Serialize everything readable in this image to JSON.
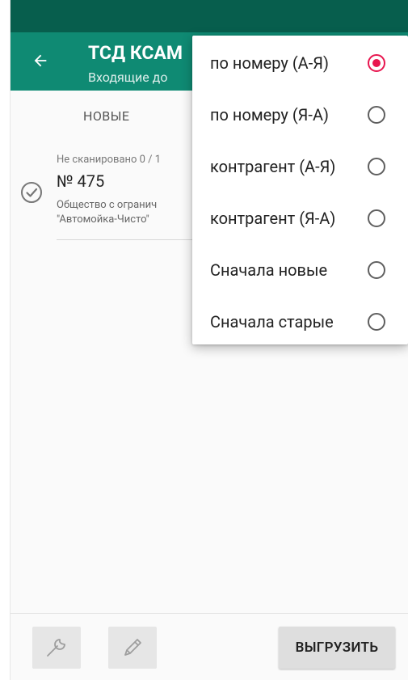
{
  "app_bar": {
    "title": "ТСД КСАМ",
    "subtitle": "Входящие до"
  },
  "tabs": {
    "new_label": "НОВЫЕ"
  },
  "document": {
    "scan_status": "Не сканировано 0 / 1",
    "number": "№ 475",
    "org_line1": "Общество с огранич",
    "org_line2": "\"Автомойка-Чисто\""
  },
  "sort_menu": {
    "items": [
      {
        "label": "по номеру (А-Я)",
        "selected": true
      },
      {
        "label": "по номеру (Я-А)",
        "selected": false
      },
      {
        "label": "контрагент (А-Я)",
        "selected": false
      },
      {
        "label": "контрагент (Я-А)",
        "selected": false
      },
      {
        "label": "Сначала новые",
        "selected": false
      },
      {
        "label": "Сначала старые",
        "selected": false
      }
    ]
  },
  "bottom_bar": {
    "upload_label": "ВЫГРУЗИТЬ"
  },
  "colors": {
    "status_bar": "#075e4d",
    "app_bar": "#0f8a73",
    "radio_selected": "#e8164f"
  },
  "icons": [
    "back-arrow-icon",
    "check-circle-icon",
    "wrench-icon",
    "pencil-icon"
  ]
}
